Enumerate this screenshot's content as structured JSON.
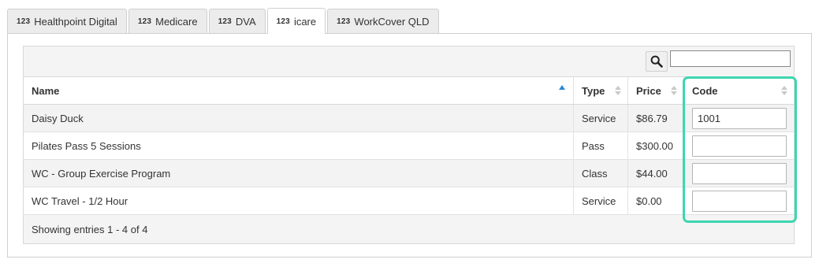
{
  "tabs": [
    {
      "badge": "123",
      "label": "Healthpoint Digital",
      "active": false
    },
    {
      "badge": "123",
      "label": "Medicare",
      "active": false
    },
    {
      "badge": "123",
      "label": "DVA",
      "active": false
    },
    {
      "badge": "123",
      "label": "icare",
      "active": true
    },
    {
      "badge": "123",
      "label": "WorkCover QLD",
      "active": false
    }
  ],
  "search": {
    "icon": "search-icon",
    "value": ""
  },
  "table": {
    "columns": {
      "name": "Name",
      "type": "Type",
      "price": "Price",
      "code": "Code"
    },
    "sorted_column": "name",
    "sort_direction": "ascending",
    "rows": [
      {
        "name": "Daisy Duck",
        "type": "Service",
        "price": "$86.79",
        "code": "1001"
      },
      {
        "name": "Pilates Pass 5 Sessions",
        "type": "Pass",
        "price": "$300.00",
        "code": ""
      },
      {
        "name": "WC - Group Exercise Program",
        "type": "Class",
        "price": "$44.00",
        "code": ""
      },
      {
        "name": "WC Travel - 1/2 Hour",
        "type": "Service",
        "price": "$0.00",
        "code": ""
      }
    ],
    "footer": "Showing entries 1 - 4 of 4"
  },
  "colors": {
    "highlight": "#3dd6b0",
    "sort_active": "#2a8ad4"
  }
}
